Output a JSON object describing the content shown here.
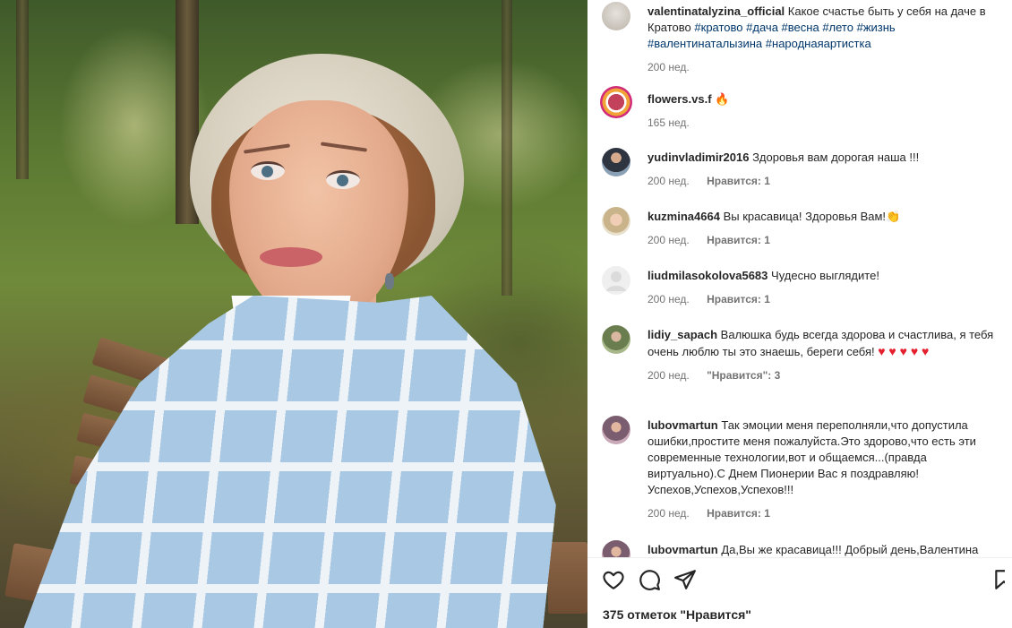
{
  "post": {
    "photo_alt_subject": "portrait",
    "likes_text": "375 отметок \"Нравится\""
  },
  "comments": [
    {
      "user": "valentinatalyzina_official",
      "text_before": "Какое счастье быть у себя на даче в Кратово",
      "hashtags": [
        "#кратово",
        "#дача",
        "#весна",
        "#лето",
        "#жизнь",
        "#валентинаталызина",
        "#народнаяартистка"
      ],
      "time": "200 нед.",
      "likes": ""
    },
    {
      "user": "flowers.vs.f",
      "text": "🔥",
      "time": "165 нед.",
      "likes": ""
    },
    {
      "user": "yudinvladimir2016",
      "text": "Здоровья вам дорогая наша !!!",
      "time": "200 нед.",
      "likes": "Нравится: 1"
    },
    {
      "user": "kuzmina4664",
      "text": "Вы красавица! Здоровья Вам!👏",
      "time": "200 нед.",
      "likes": "Нравится: 1"
    },
    {
      "user": "liudmilasokolova5683",
      "text": "Чудесно выглядите!",
      "time": "200 нед.",
      "likes": "Нравится: 1"
    },
    {
      "user": "lidiy_sapach",
      "text": "Валюшка будь всегда здорова и счастлива, я тебя очень люблю ты это знаешь, береги себя!",
      "hearts": "♥ ♥ ♥ ♥ ♥",
      "time": "200 нед.",
      "likes": "\"Нравится\": 3"
    },
    {
      "user": "lubovmartun",
      "text": "Так эмоции меня переполняли,что допустила ошибки,простите меня пожалуйста.Это здорово,что есть эти современные технологии,вот и общаемся...(правда виртуально).С Днем Пионерии Вас я поздравляю! Успехов,Успехов,Успехов!!!",
      "time": "200 нед.",
      "likes": "Нравится: 1"
    },
    {
      "user": "lubovmartun",
      "text": "Да,Вы же красавица!!! Добрый день,Валентина",
      "time": "",
      "likes": ""
    }
  ],
  "icons": {
    "like": "heart-icon",
    "comment": "comment-icon",
    "share": "share-icon",
    "save": "bookmark-icon"
  },
  "colors": {
    "text": "#262626",
    "meta": "#737373",
    "hashtag": "#00376b",
    "heart": "#e5202e"
  }
}
